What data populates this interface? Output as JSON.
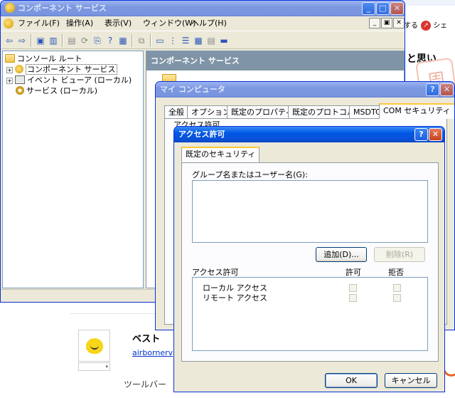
{
  "background": {
    "tools": [
      {
        "label": "する"
      },
      {
        "label": "シェ"
      }
    ],
    "heading": "と思い",
    "stamp_text": "周",
    "card": {
      "best_label": "ベスト",
      "link_text": "airbornerv",
      "toolbar_text": "ツールバー"
    }
  },
  "mmc": {
    "title": "コンポーネント サービス",
    "menu": [
      "ファイル(F)",
      "操作(A)",
      "表示(V)",
      "ウィンドウ(W)",
      "ヘルプ(H)"
    ],
    "tree": [
      {
        "label": "コンソール ルート",
        "icon": "folder-icon"
      },
      {
        "label": "コンポーネント サービス",
        "icon": "component-services-icon"
      },
      {
        "label": "イベント ビューア (ローカル)",
        "icon": "event-viewer-icon"
      },
      {
        "label": "サービス (ローカル)",
        "icon": "services-gear-icon"
      }
    ],
    "right_header": "コンポーネント サービス"
  },
  "props": {
    "title": "マイ コンピュータ",
    "tabs": [
      "全般",
      "オプション",
      "既定のプロパティ",
      "既定のプロトコル",
      "MSDTC",
      "COM セキュリティ"
    ],
    "active_tab": "COM セキュリティ",
    "group_label": "アクセス許可"
  },
  "access": {
    "title": "アクセス許可",
    "tab": "既定のセキュリティ",
    "group_user_label": "グループ名またはユーザー名(G):",
    "add_label": "追加(D)...",
    "remove_label": "削除(R)",
    "perm_header": "アクセス許可",
    "allow_header": "許可",
    "deny_header": "拒否",
    "permissions": [
      {
        "name": "ローカル アクセス",
        "allow": false,
        "deny": false
      },
      {
        "name": "リモート アクセス",
        "allow": false,
        "deny": false
      }
    ],
    "ok_label": "OK",
    "cancel_label": "キャンセル"
  },
  "colors": {
    "xp_title_active": "#0058e6",
    "xp_title_inactive": "#7b97e0",
    "dialog_face": "#ece9d8",
    "header_bar": "#7f94a6"
  }
}
